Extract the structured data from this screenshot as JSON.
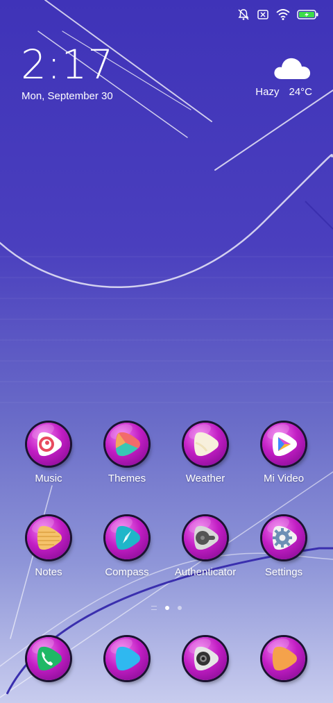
{
  "status_bar": {
    "icons": [
      "notifications-off-icon",
      "sim-off-icon",
      "wifi-icon",
      "battery-charging-icon"
    ],
    "battery_color": "#3ddc4a"
  },
  "lockscreen": {
    "time": "2:17",
    "date": "Mon, September 30"
  },
  "weather": {
    "icon": "cloud-icon",
    "condition": "Hazy",
    "temperature": "24°C"
  },
  "home": {
    "apps": [
      {
        "label": "Music",
        "icon": "music-icon"
      },
      {
        "label": "Themes",
        "icon": "themes-icon"
      },
      {
        "label": "Weather",
        "icon": "weather-icon"
      },
      {
        "label": "Mi Video",
        "icon": "video-icon"
      },
      {
        "label": "Notes",
        "icon": "notes-icon"
      },
      {
        "label": "Compass",
        "icon": "compass-icon"
      },
      {
        "label": "Authenticator",
        "icon": "authenticator-icon"
      },
      {
        "label": "Settings",
        "icon": "settings-icon"
      }
    ],
    "page_indicator": {
      "pages": 2,
      "current": 1
    }
  },
  "dock": {
    "apps": [
      {
        "icon": "phone-icon"
      },
      {
        "icon": "messages-icon"
      },
      {
        "icon": "camera-icon"
      },
      {
        "icon": "browser-icon"
      }
    ]
  },
  "theme": {
    "accent": "#c21ec4",
    "background_top": "#3f33b8",
    "background_bottom": "#c8ccee"
  }
}
